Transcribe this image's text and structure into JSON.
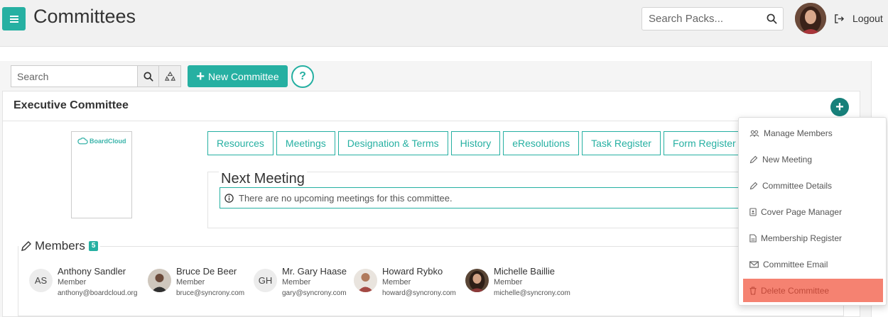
{
  "header": {
    "title": "Committees",
    "search_placeholder": "Search Packs...",
    "logout_label": "Logout"
  },
  "toolbar": {
    "search_placeholder": "Search",
    "new_committee_label": "New Committee",
    "help_label": "?"
  },
  "committee": {
    "title": "Executive Committee",
    "logo_text": "BoardCloud",
    "tabs": [
      "Resources",
      "Meetings",
      "Designation & Terms",
      "History",
      "eResolutions",
      "Task Register",
      "Form Register"
    ],
    "next_meeting": {
      "title": "Next Meeting",
      "message": "There are no upcoming meetings for this committee."
    },
    "members": {
      "title": "Members",
      "count": "5",
      "list": [
        {
          "initials": "AS",
          "name": "Anthony Sandler",
          "role": "Member",
          "email": "anthony@boardcloud.org"
        },
        {
          "initials": "",
          "name": "Bruce De Beer",
          "role": "Member",
          "email": "bruce@syncrony.com"
        },
        {
          "initials": "GH",
          "name": "Mr. Gary Haase",
          "role": "Member",
          "email": "gary@syncrony.com"
        },
        {
          "initials": "",
          "name": "Howard Rybko",
          "role": "Member",
          "email": "howard@syncrony.com"
        },
        {
          "initials": "",
          "name": "Michelle Baillie",
          "role": "Member",
          "email": "michelle@syncrony.com"
        }
      ]
    }
  },
  "dropdown": {
    "items": [
      {
        "label": "Manage Members",
        "icon": "users-icon"
      },
      {
        "label": "New Meeting",
        "icon": "pencil-icon"
      },
      {
        "label": "Committee Details",
        "icon": "pencil-icon"
      },
      {
        "label": "Cover Page Manager",
        "icon": "id-card-icon"
      },
      {
        "label": "Membership Register",
        "icon": "document-icon"
      },
      {
        "label": "Committee Email",
        "icon": "envelope-icon"
      },
      {
        "label": "Delete Committee",
        "icon": "trash-icon"
      }
    ]
  },
  "colors": {
    "accent": "#26b0a2",
    "accent_dark": "#17807a",
    "danger": "#f58271"
  }
}
